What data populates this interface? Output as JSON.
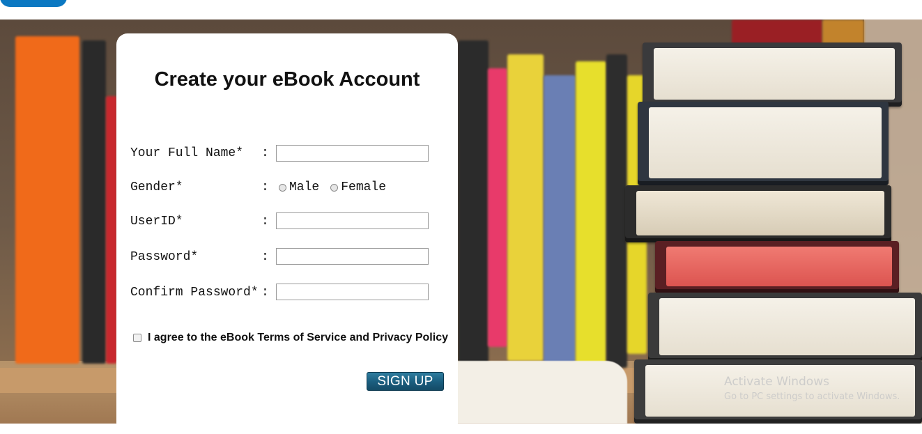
{
  "form": {
    "title": "Create your eBook Account",
    "full_name_label": "Your Full Name*  ",
    "gender_label": "Gender*",
    "userid_label": "UserID*",
    "password_label": "Password*",
    "confirm_password_label": "Confirm Password*",
    "colon": ":",
    "gender_options": [
      "Male",
      "Female"
    ],
    "full_name_value": "",
    "userid_value": "",
    "password_value": "",
    "confirm_password_value": "",
    "agree_text": "I agree to the eBook Terms of Service and Privacy Policy",
    "signup_label": "SIGN UP"
  },
  "watermark": {
    "line1": "Activate Windows",
    "line2": "Go to PC settings to activate Windows."
  },
  "colors": {
    "header_accent": "#0b78c2",
    "signup_button": "#1b5f80"
  }
}
